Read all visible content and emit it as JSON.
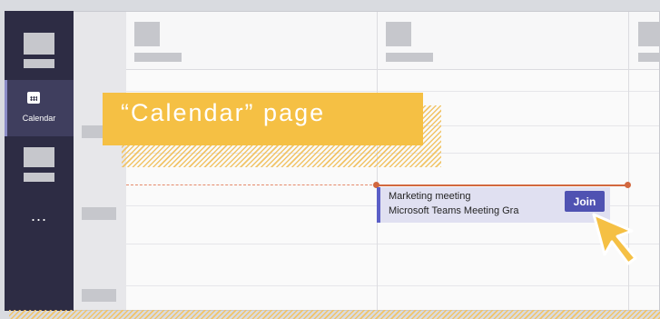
{
  "rail": {
    "calendar_label": "Calendar",
    "more_label": "..."
  },
  "callout": {
    "text": "“Calendar” page"
  },
  "event": {
    "title": "Marketing meeting",
    "subtitle": "Microsoft Teams Meeting Gra",
    "join_label": "Join"
  },
  "icons": {
    "calendar": "calendar-icon",
    "more": "more-icon",
    "cursor": "pointer-cursor-icon"
  },
  "colors": {
    "rail": "#2d2c44",
    "accent": "#5b5fc7",
    "join_button": "#4f52b2",
    "now_line": "#d2683f",
    "callout": "#f5c044"
  }
}
